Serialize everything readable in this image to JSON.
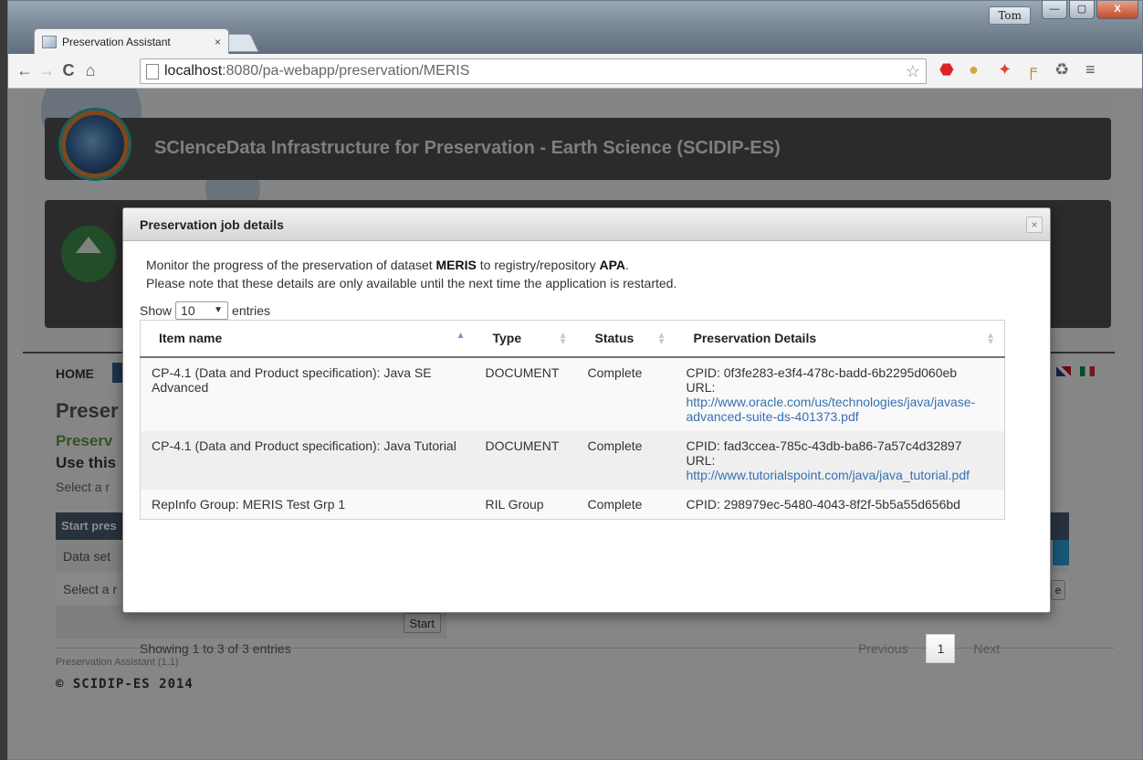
{
  "window": {
    "profile_label": "Tom",
    "min_label": "—",
    "max_label": "▢",
    "close_label": "X"
  },
  "browser": {
    "tab_title": "Preservation Assistant",
    "tab_close": "×",
    "url_host": "localhost",
    "url_rest": ":8080/pa-webapp/preservation/MERIS",
    "back_glyph": "←",
    "forward_glyph": "→",
    "reload_glyph": "C",
    "home_glyph": "⌂",
    "star_glyph": "☆",
    "menu_glyph": "≡"
  },
  "site": {
    "title": "SCIenceData Infrastructure for Preservation - Earth Science (SCIDIP-ES)",
    "nav_home": "HOME",
    "heading_partial": "Preser",
    "green_partial": "Preserv",
    "use_partial": "Use this",
    "select_partial": "Select a r",
    "start_bar_partial": "Start pres",
    "dataset_label": "Data set",
    "select_row_partial": "Select a r",
    "edge_button_partial": "e",
    "start_button": "Start",
    "footer_app": "Preservation Assistant (1.1)",
    "footer_copy": "© SCIDIP-ES 2014"
  },
  "modal": {
    "title": "Preservation job details",
    "close": "×",
    "intro_prefix": "Monitor the progress of the preservation of dataset ",
    "dataset": "MERIS",
    "intro_mid": " to registry/repository ",
    "repository": "APA",
    "intro_suffix": ".",
    "note": "Please note that these details are only available until the next time the application is restarted.",
    "show_label": "Show",
    "page_length": "10",
    "entries_label": "entries",
    "columns": [
      "Item name",
      "Type",
      "Status",
      "Preservation Details"
    ],
    "rows": [
      {
        "item_name": "CP-4.1 (Data and Product specification): Java SE Advanced",
        "type": "DOCUMENT",
        "status": "Complete",
        "cpid": "CPID: 0f3fe283-e3f4-478c-badd-6b2295d060eb",
        "url_label": "URL:",
        "url": "http://www.oracle.com/us/technologies/java/javase-advanced-suite-ds-401373.pdf"
      },
      {
        "item_name": "CP-4.1 (Data and Product specification): Java Tutorial",
        "type": "DOCUMENT",
        "status": "Complete",
        "cpid": "CPID: fad3ccea-785c-43db-ba86-7a57c4d32897",
        "url_label": "URL:",
        "url": "http://www.tutorialspoint.com/java/java_tutorial.pdf"
      },
      {
        "item_name": "RepInfo Group: MERIS Test Grp 1",
        "type": "RIL Group",
        "status": "Complete",
        "cpid": "CPID: 298979ec-5480-4043-8f2f-5b5a55d656bd"
      }
    ],
    "info": "Showing 1 to 3 of 3 entries",
    "prev": "Previous",
    "current_page": "1",
    "next": "Next"
  }
}
